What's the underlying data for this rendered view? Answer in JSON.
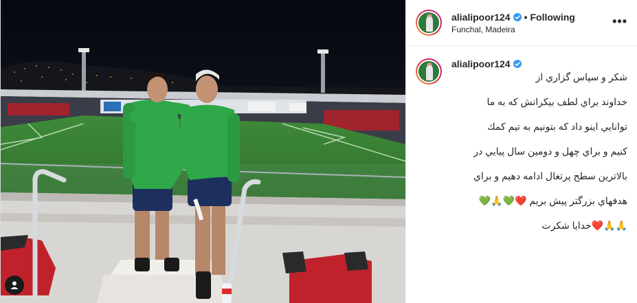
{
  "post": {
    "username": "alialipoor124",
    "follow_status": "Following",
    "separator": "•",
    "location": "Funchal, Madeira",
    "more_icon": "more-horizontal-icon",
    "caption_lines": [
      "شکر و سپاس گزاري از",
      "خداوند براي لطف بيکرانش که به ما",
      "توانايي اينو داد که بتونيم به تيم کمك",
      "كنيم و براي چهل و دومين سال پيايي در",
      "بالاترين سطح پرتغال ادامه دهيم و براي",
      "هدفهاي بزرگتر پيش بريم ❤️💚🙏💚",
      "🙏🙏❤️خدايا شکرت"
    ],
    "colors": {
      "verified": "#3897f0",
      "text": "#262626",
      "border": "#dbdbdb",
      "jersey": "#2fa84a"
    }
  }
}
